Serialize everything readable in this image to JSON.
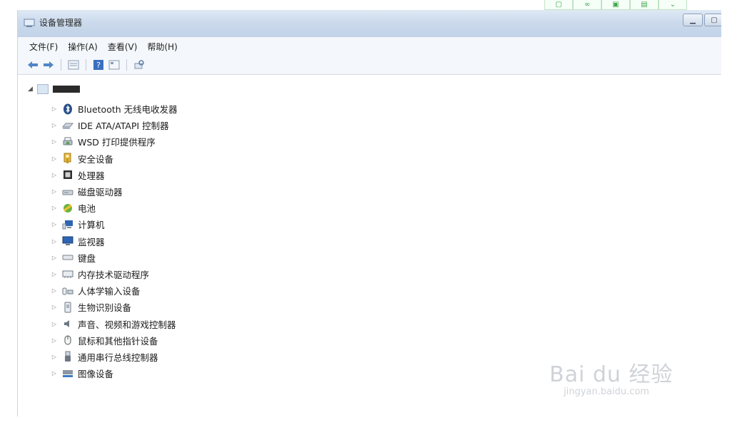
{
  "window": {
    "title": "设备管理器"
  },
  "menu": [
    "文件(F)",
    "操作(A)",
    "查看(V)",
    "帮助(H)"
  ],
  "toolbar": {
    "buttons": [
      "back-arrow-icon",
      "forward-arrow-icon",
      "properties-icon",
      "help-icon",
      "view-icon",
      "scan-hardware-icon"
    ]
  },
  "tree": {
    "categories": [
      {
        "label": "Bluetooth 无线电收发器",
        "icon": "bluetooth-icon"
      },
      {
        "label": "IDE ATA/ATAPI 控制器",
        "icon": "ide-controller-icon"
      },
      {
        "label": "WSD 打印提供程序",
        "icon": "printer-icon"
      },
      {
        "label": "安全设备",
        "icon": "security-device-icon"
      },
      {
        "label": "处理器",
        "icon": "processor-icon"
      },
      {
        "label": "磁盘驱动器",
        "icon": "disk-drive-icon"
      },
      {
        "label": "电池",
        "icon": "battery-icon"
      },
      {
        "label": "计算机",
        "icon": "computer-icon"
      },
      {
        "label": "监视器",
        "icon": "monitor-icon"
      },
      {
        "label": "键盘",
        "icon": "keyboard-icon"
      },
      {
        "label": "内存技术驱动程序",
        "icon": "memory-tech-icon"
      },
      {
        "label": "人体学输入设备",
        "icon": "hid-icon"
      },
      {
        "label": "生物识别设备",
        "icon": "biometric-icon"
      },
      {
        "label": "声音、视频和游戏控制器",
        "icon": "sound-icon"
      },
      {
        "label": "鼠标和其他指针设备",
        "icon": "mouse-icon"
      },
      {
        "label": "通用串行总线控制器",
        "icon": "usb-icon"
      },
      {
        "label": "图像设备",
        "icon": "imaging-device-icon"
      }
    ]
  },
  "watermark": {
    "brand": "Bai du 经验",
    "url": "jingyan.baidu.com"
  }
}
